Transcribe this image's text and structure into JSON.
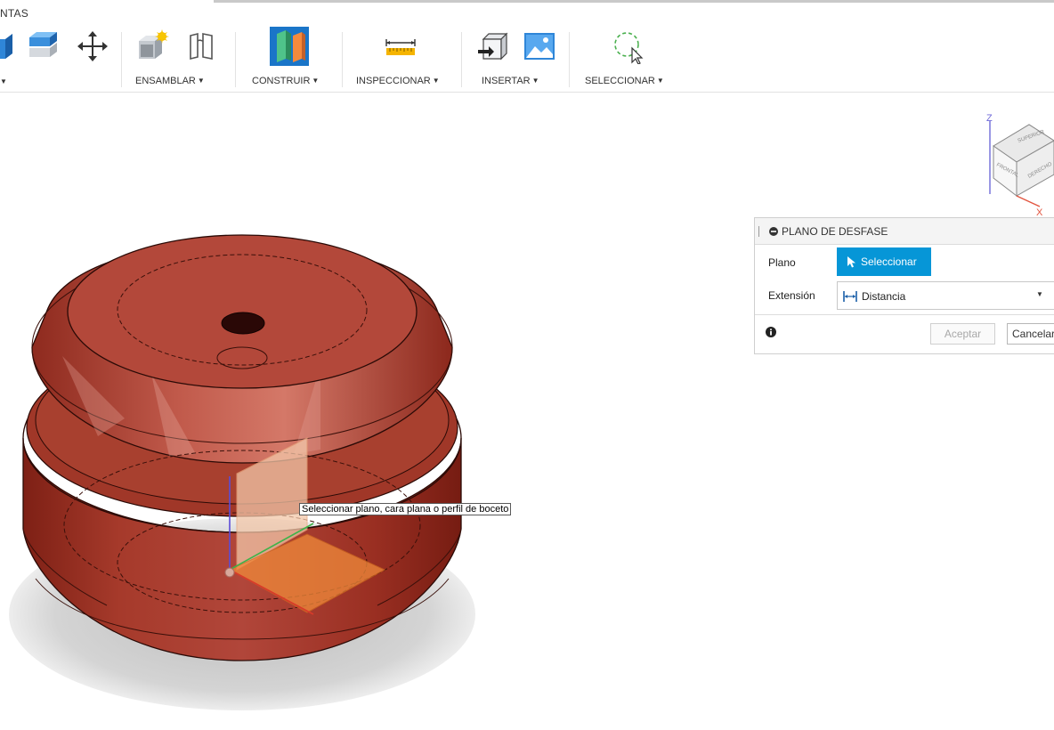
{
  "toolbar": {
    "tab_label": "NTAS",
    "groups": {
      "ensamblar": "ENSAMBLAR",
      "construir": "CONSTRUIR",
      "inspeccionar": "INSPECCIONAR",
      "insertar": "INSERTAR",
      "seleccionar": "SELECCIONAR"
    },
    "dropdown_glyph": "▼"
  },
  "viewcube": {
    "axis_z": "Z",
    "axis_x": "X",
    "top_face": "SUPERIOR",
    "front_face": "FRONTAL",
    "right_face": "DERECHO"
  },
  "tooltip": {
    "text": "Seleccionar plano, cara plana o perfil de boceto"
  },
  "dialog": {
    "title": "PLANO DE DESFASE",
    "plane_label": "Plano",
    "select_button": "Seleccionar",
    "extent_label": "Extensión",
    "extent_value": "Distancia",
    "accept_button": "Aceptar",
    "cancel_button": "Cancelar"
  },
  "colors": {
    "accent": "#0696d7",
    "model_body": "#9b2f22",
    "model_top": "#b5493a",
    "plane_highlight": "#f08a3a"
  },
  "icons": [
    "extrude-icon",
    "press-pull-icon",
    "move-icon",
    "new-component-icon",
    "joint-icon",
    "offset-plane-icon",
    "measure-icon",
    "insert-mesh-icon",
    "decal-icon",
    "select-icon",
    "cursor-icon",
    "info-icon",
    "distance-icon"
  ]
}
